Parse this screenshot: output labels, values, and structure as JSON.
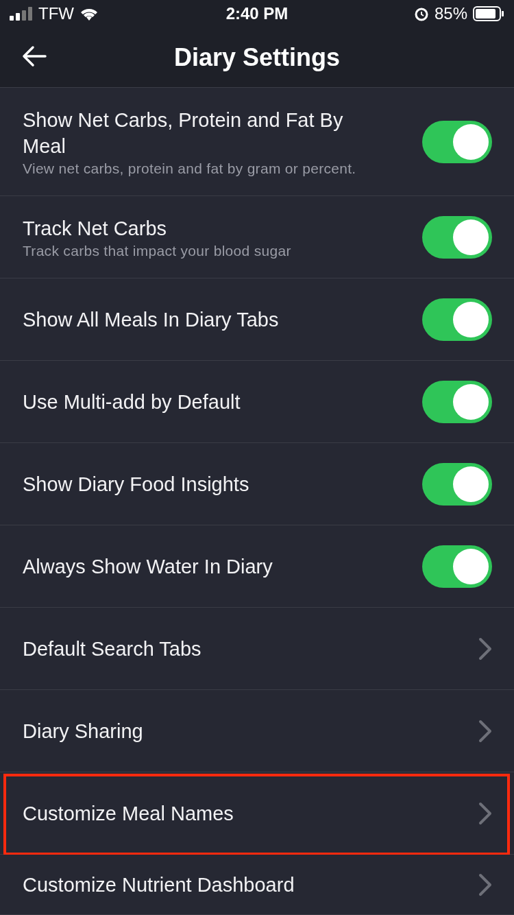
{
  "status_bar": {
    "carrier": "TFW",
    "time": "2:40 PM",
    "battery": "85%"
  },
  "header": {
    "title": "Diary Settings"
  },
  "rows": [
    {
      "kind": "toggle",
      "label": "Show Net Carbs, Protein and Fat By Meal",
      "subtitle": "View net carbs, protein and fat by gram or percent.",
      "on": true,
      "highlighted": false
    },
    {
      "kind": "toggle",
      "label": "Track Net Carbs",
      "subtitle": "Track carbs that impact your blood sugar",
      "on": true,
      "highlighted": false
    },
    {
      "kind": "toggle",
      "label": "Show All Meals In Diary Tabs",
      "on": true,
      "highlighted": false
    },
    {
      "kind": "toggle",
      "label": "Use Multi-add by Default",
      "on": true,
      "highlighted": false
    },
    {
      "kind": "toggle",
      "label": "Show Diary Food Insights",
      "on": true,
      "highlighted": false
    },
    {
      "kind": "toggle",
      "label": "Always Show Water In Diary",
      "on": true,
      "highlighted": false
    },
    {
      "kind": "link",
      "label": "Default Search Tabs",
      "highlighted": false
    },
    {
      "kind": "link",
      "label": "Diary Sharing",
      "highlighted": false
    },
    {
      "kind": "link",
      "label": "Customize Meal Names",
      "highlighted": true
    },
    {
      "kind": "link",
      "label": "Customize Nutrient Dashboard",
      "highlighted": false
    }
  ]
}
